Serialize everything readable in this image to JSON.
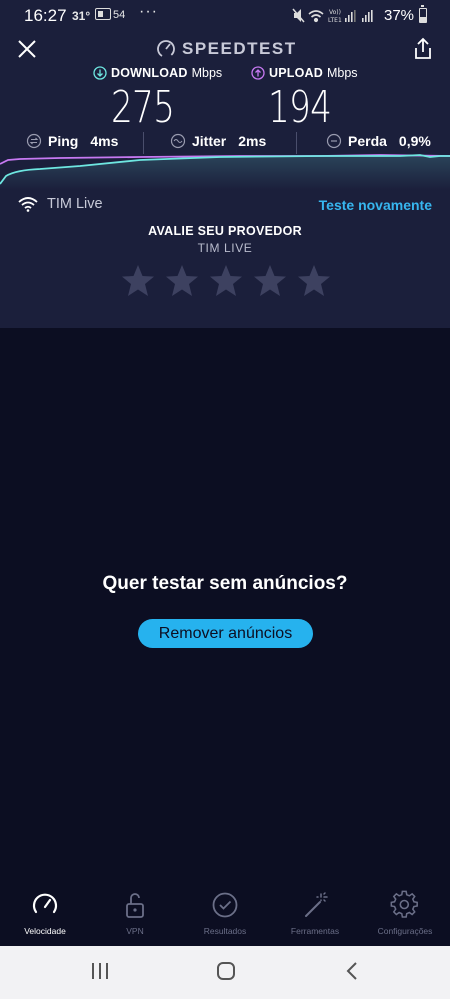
{
  "status_bar": {
    "time": "16:27",
    "temperature": "31°",
    "notification": "54",
    "more": "···",
    "network": "LTE1",
    "battery_percent": "37%"
  },
  "header": {
    "title": "SPEEDTEST"
  },
  "results": {
    "download_label": "DOWNLOAD",
    "download_unit": "Mbps",
    "download_value": "275",
    "upload_label": "UPLOAD",
    "upload_unit": "Mbps",
    "upload_value": "194",
    "ping_label": "Ping",
    "ping_value": "4ms",
    "jitter_label": "Jitter",
    "jitter_value": "2ms",
    "loss_label": "Perda",
    "loss_value": "0,9%"
  },
  "provider": {
    "name": "TIM Live",
    "retest_label": "Teste novamente",
    "rate_title": "AVALIE SEU PROVEDOR",
    "rate_subtitle": "TIM LIVE",
    "rating": 0,
    "max_rating": 5
  },
  "ad": {
    "question": "Quer testar sem anúncios?",
    "button_label": "Remover anúncios"
  },
  "bottom_nav": {
    "items": [
      {
        "label": "Velocidade",
        "icon": "speedometer-icon",
        "active": true
      },
      {
        "label": "VPN",
        "icon": "lock-open-icon",
        "active": false
      },
      {
        "label": "Resultados",
        "icon": "check-circle-icon",
        "active": false
      },
      {
        "label": "Ferramentas",
        "icon": "magic-wand-icon",
        "active": false
      },
      {
        "label": "Configurações",
        "icon": "gear-icon",
        "active": false
      }
    ]
  },
  "colors": {
    "accent": "#26b2ee",
    "download": "#6ee7e1",
    "upload": "#c779f2",
    "panel_bg": "#1b1f3b",
    "page_bg": "#0c0e22"
  }
}
